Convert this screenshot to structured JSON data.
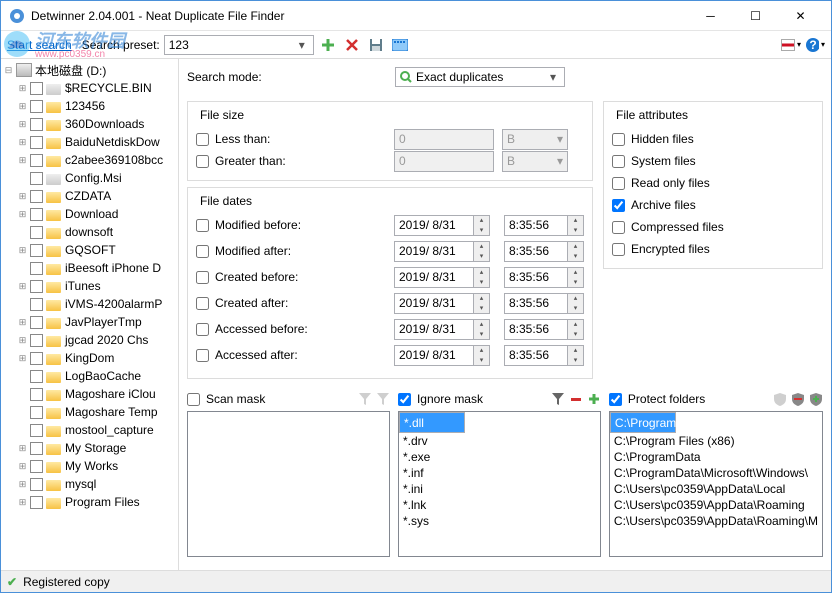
{
  "window": {
    "title": "Detwinner 2.04.001 - Neat Duplicate File Finder"
  },
  "toolbar": {
    "start_search": "Start search",
    "preset_label": "Search preset:",
    "preset_value": "123"
  },
  "tree": {
    "root": "本地磁盘 (D:)",
    "items": [
      {
        "label": "$RECYCLE.BIN",
        "gray": true
      },
      {
        "label": "123456"
      },
      {
        "label": "360Downloads"
      },
      {
        "label": "BaiduNetdiskDow"
      },
      {
        "label": "c2abee369108bcc"
      },
      {
        "label": "Config.Msi",
        "gray": true,
        "noexp": true
      },
      {
        "label": "CZDATA"
      },
      {
        "label": "Download"
      },
      {
        "label": "downsoft",
        "noexp": true
      },
      {
        "label": "GQSOFT"
      },
      {
        "label": "iBeesoft iPhone D",
        "noexp": true
      },
      {
        "label": "iTunes"
      },
      {
        "label": "iVMS-4200alarmP",
        "noexp": true
      },
      {
        "label": "JavPlayerTmp"
      },
      {
        "label": "jgcad 2020 Chs"
      },
      {
        "label": "KingDom"
      },
      {
        "label": "LogBaoCache",
        "noexp": true
      },
      {
        "label": "Magoshare iClou",
        "noexp": true
      },
      {
        "label": "Magoshare Temp",
        "noexp": true
      },
      {
        "label": "mostool_capture",
        "noexp": true
      },
      {
        "label": "My Storage"
      },
      {
        "label": "My Works"
      },
      {
        "label": "mysql"
      },
      {
        "label": "Program Files"
      }
    ]
  },
  "search_mode": {
    "label": "Search mode:",
    "value": "Exact duplicates"
  },
  "filesize": {
    "title": "File size",
    "less": "Less than:",
    "greater": "Greater than:",
    "val": "0",
    "unit": "B"
  },
  "filedates": {
    "title": "File dates",
    "rows": [
      {
        "label": "Modified before:",
        "date": "2019/ 8/31",
        "time": "8:35:56"
      },
      {
        "label": "Modified after:",
        "date": "2019/ 8/31",
        "time": "8:35:56"
      },
      {
        "label": "Created before:",
        "date": "2019/ 8/31",
        "time": "8:35:56"
      },
      {
        "label": "Created after:",
        "date": "2019/ 8/31",
        "time": "8:35:56"
      },
      {
        "label": "Accessed before:",
        "date": "2019/ 8/31",
        "time": "8:35:56"
      },
      {
        "label": "Accessed after:",
        "date": "2019/ 8/31",
        "time": "8:35:56"
      }
    ]
  },
  "attrs": {
    "title": "File attributes",
    "items": [
      {
        "label": "Hidden files",
        "checked": false
      },
      {
        "label": "System files",
        "checked": false
      },
      {
        "label": "Read only files",
        "checked": false
      },
      {
        "label": "Archive files",
        "checked": true
      },
      {
        "label": "Compressed files",
        "checked": false
      },
      {
        "label": "Encrypted files",
        "checked": false
      }
    ]
  },
  "masks": {
    "scan": {
      "label": "Scan mask",
      "checked": false,
      "items": []
    },
    "ignore": {
      "label": "Ignore mask",
      "checked": true,
      "items": [
        "*.dll",
        "*.drv",
        "*.exe",
        "*.inf",
        "*.ini",
        "*.lnk",
        "*.sys"
      ]
    },
    "protect": {
      "label": "Protect folders",
      "checked": true,
      "items": [
        "C:\\Program Files",
        "C:\\Program Files (x86)",
        "C:\\ProgramData",
        "C:\\ProgramData\\Microsoft\\Windows\\",
        "C:\\Users\\pc0359\\AppData\\Local",
        "C:\\Users\\pc0359\\AppData\\Roaming",
        "C:\\Users\\pc0359\\AppData\\Roaming\\M"
      ]
    }
  },
  "status": {
    "text": "Registered copy"
  },
  "watermark": {
    "text": "河东软件园",
    "url": "www.pc0359.cn"
  }
}
